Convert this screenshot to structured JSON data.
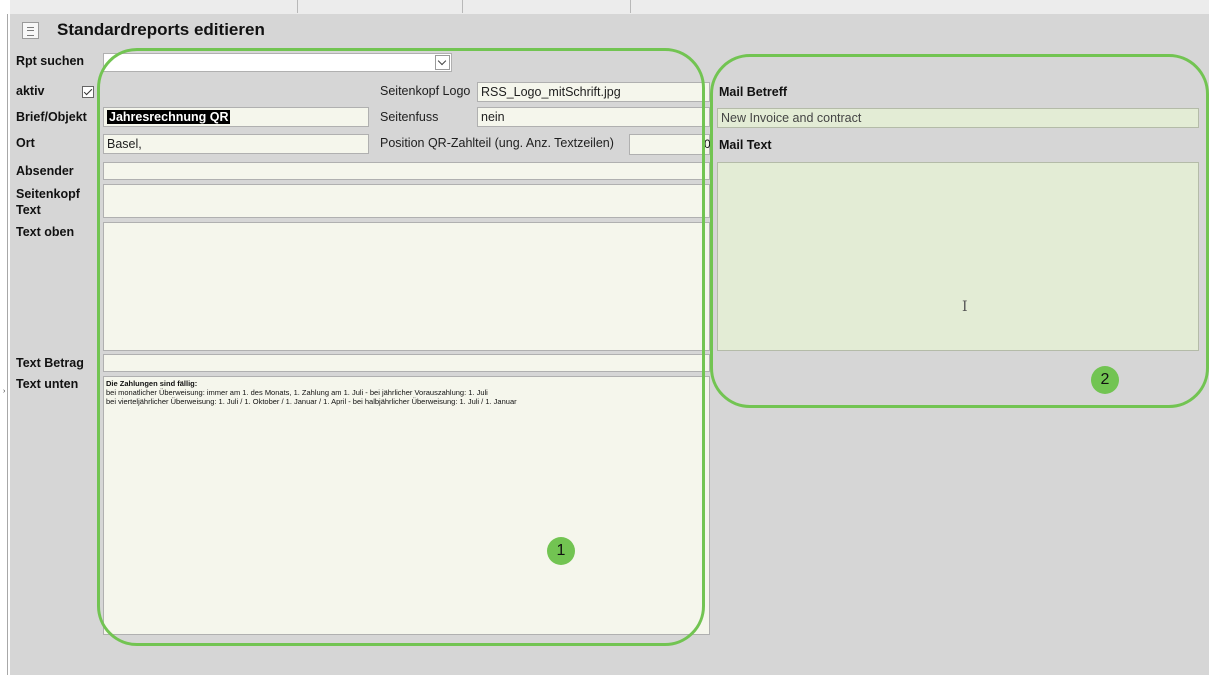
{
  "window": {
    "title": "Standardreports editieren"
  },
  "labels": {
    "rpt_suchen": "Rpt suchen",
    "aktiv": "aktiv",
    "brief_objekt": "Brief/Objekt",
    "ort": "Ort",
    "absender": "Absender",
    "seitenkopf_text_1": "Seitenkopf",
    "seitenkopf_text_2": "Text",
    "text_oben": "Text oben",
    "text_betrag": "Text Betrag",
    "text_unten": "Text unten",
    "seitenkopf_logo": "Seitenkopf Logo",
    "seitenfuss": "Seitenfuss",
    "position_qr": "Position QR-Zahlteil (ung. Anz. Textzeilen)",
    "mail_betreff": "Mail Betreff",
    "mail_text": "Mail Text"
  },
  "fields": {
    "rpt_suchen": "",
    "aktiv": true,
    "brief_objekt": "Jahresrechnung QR",
    "ort": "Basel,",
    "absender": "",
    "seitenkopf_text": "",
    "text_oben": "",
    "text_betrag": "",
    "text_unten": {
      "line1": "Die Zahlungen sind fällig:",
      "line2": "bei monatlicher Überweisung:  immer am 1. des Monats, 1. Zahlung am 1. Juli   -  bei jährlicher Vorauszahlung: 1. Juli",
      "line3": "bei vierteljährlicher Überweisung: 1. Juli / 1. Oktober / 1. Januar / 1. April  -  bei halbjährlicher Überweisung: 1. Juli / 1. Januar"
    },
    "seitenkopf_logo": "RSS_Logo_mitSchrift.jpg",
    "seitenfuss": "nein",
    "position_qr": "",
    "position_qr_overflow": "0",
    "mail_betreff": "New Invoice and contract",
    "mail_text": ""
  },
  "callouts": {
    "badge1": "1",
    "badge2": "2"
  },
  "colors": {
    "callout": "#72c452",
    "field_bg": "#f5f6ec",
    "mail_bg": "#e3ecd5",
    "form_bg": "#d6d6d6"
  },
  "icons": {
    "form": "form-icon",
    "dropdown": "chevron-down-icon",
    "checkbox": "checkbox-checked-icon",
    "cursor": "text-cursor-icon"
  }
}
